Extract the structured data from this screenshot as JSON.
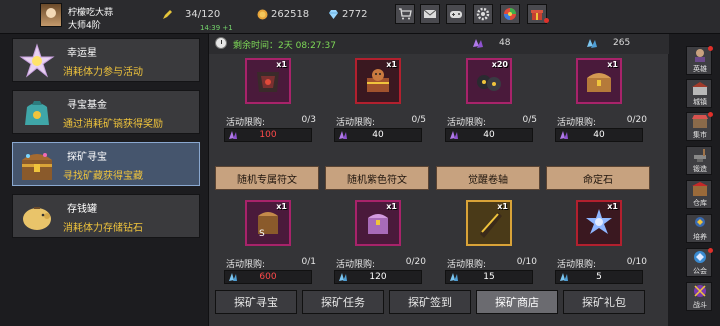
{
  "player": {
    "name": "柠檬吃大蒜",
    "rank": "大师4阶"
  },
  "resources": {
    "stamina": "34/120",
    "stamina_timer": "14:39 +1",
    "gold": "262518",
    "diamonds": "2772"
  },
  "top_buttons": [
    "shop-icon",
    "mail-icon",
    "gamepad-icon",
    "gear-icon",
    "wheel-icon",
    "gift-icon"
  ],
  "left_menu": [
    {
      "title": "幸运星",
      "desc": "消耗体力参与活动",
      "icon": "lucky-star-icon"
    },
    {
      "title": "寻宝基金",
      "desc": "通过消耗矿镐获得奖励",
      "icon": "treasure-fund-icon"
    },
    {
      "title": "探矿寻宝",
      "desc": "寻找矿藏获得宝藏",
      "icon": "treasure-chest-icon",
      "active": true
    },
    {
      "title": "存钱罐",
      "desc": "消耗体力存储钻石",
      "icon": "piggy-bank-icon"
    }
  ],
  "shop": {
    "remaining_label": "剩余时间：2天 08:27:37",
    "purple_crystal_count": "48",
    "blue_crystal_count": "265",
    "limit_label": "活动限购:",
    "items_row1": [
      {
        "qty": "x1",
        "limit": "0/3",
        "price": "100",
        "price_color": "red",
        "currency": "purple",
        "frame": "purple",
        "icon": "dark-armor-icon"
      },
      {
        "qty": "x1",
        "limit": "0/5",
        "price": "40",
        "price_color": "white",
        "currency": "purple",
        "frame": "red",
        "icon": "monkey-chest-icon"
      },
      {
        "qty": "x20",
        "limit": "0/5",
        "price": "40",
        "price_color": "white",
        "currency": "purple",
        "frame": "purple",
        "icon": "rune-stones-icon"
      },
      {
        "qty": "x1",
        "limit": "0/20",
        "price": "40",
        "price_color": "white",
        "currency": "purple",
        "frame": "purple",
        "icon": "gold-chest-icon"
      }
    ],
    "items_row2": [
      {
        "banner": "随机专属符文",
        "qty": "x1",
        "limit": "0/1",
        "price": "600",
        "price_color": "red",
        "currency": "blue",
        "frame": "purple",
        "icon": "exclusive-rune-icon"
      },
      {
        "banner": "随机紫色符文",
        "qty": "x1",
        "limit": "0/20",
        "price": "120",
        "price_color": "white",
        "currency": "blue",
        "frame": "purple",
        "icon": "purple-rune-icon"
      },
      {
        "banner": "觉醒卷轴",
        "qty": "x1",
        "limit": "0/10",
        "price": "15",
        "price_color": "white",
        "currency": "blue",
        "frame": "gold",
        "icon": "awaken-scroll-icon"
      },
      {
        "banner": "命定石",
        "qty": "x1",
        "limit": "0/10",
        "price": "5",
        "price_color": "white",
        "currency": "blue",
        "frame": "red",
        "icon": "destiny-stone-icon"
      }
    ]
  },
  "bottom_tabs": [
    {
      "label": "探矿寻宝"
    },
    {
      "label": "探矿任务"
    },
    {
      "label": "探矿签到"
    },
    {
      "label": "探矿商店",
      "active": true
    },
    {
      "label": "探矿礼包"
    }
  ],
  "sidebar": [
    {
      "label": "英雄",
      "icon": "hero-icon"
    },
    {
      "label": "城镇",
      "icon": "town-icon"
    },
    {
      "label": "集市",
      "icon": "market-icon"
    },
    {
      "label": "锻造",
      "icon": "forge-icon"
    },
    {
      "label": "仓库",
      "icon": "warehouse-icon"
    },
    {
      "label": "培养",
      "icon": "train-icon"
    },
    {
      "label": "公会",
      "icon": "guild-icon"
    },
    {
      "label": "战斗",
      "icon": "battle-icon"
    }
  ],
  "colors": {
    "accent_gold": "#f0c43c",
    "timer_green": "#7ed957",
    "price_red": "#ff4a4a",
    "active_blue": "#45556d"
  }
}
